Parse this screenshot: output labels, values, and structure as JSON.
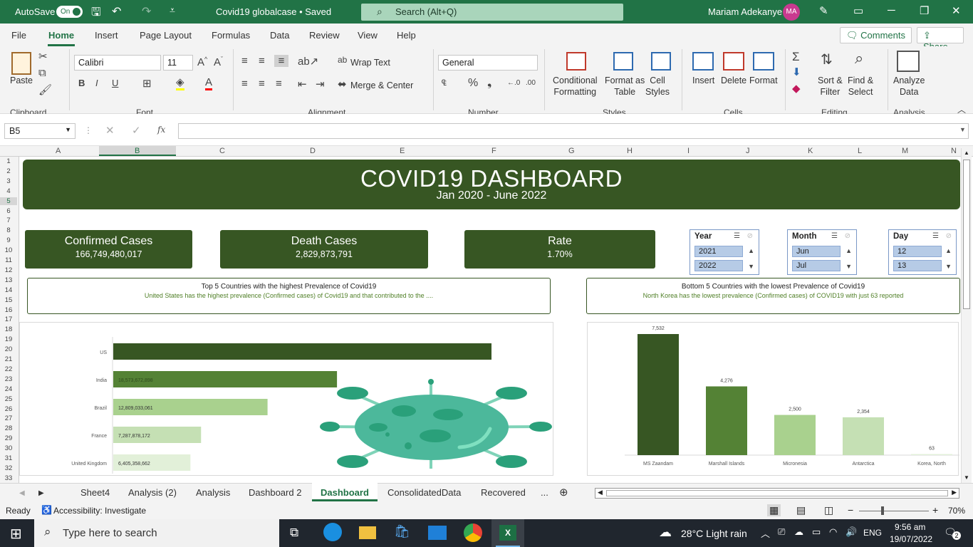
{
  "titlebar": {
    "autosave_label": "AutoSave",
    "autosave_state": "On",
    "doc_title": "Covid19 globalcase • Saved",
    "search_placeholder": "Search (Alt+Q)",
    "user_name": "Mariam Adekanye",
    "user_initials": "MA"
  },
  "menu": {
    "tabs": [
      "File",
      "Home",
      "Insert",
      "Page Layout",
      "Formulas",
      "Data",
      "Review",
      "View",
      "Help"
    ],
    "active": "Home",
    "comments_label": "Comments",
    "share_label": "Share"
  },
  "ribbon": {
    "paste_label": "Paste",
    "font_name": "Calibri",
    "font_size": "11",
    "wrap_text": "Wrap Text",
    "merge_center": "Merge & Center",
    "number_format": "General",
    "conditional_formatting": [
      "Conditional",
      "Formatting"
    ],
    "format_as_table": [
      "Format as",
      "Table"
    ],
    "cell_styles": [
      "Cell",
      "Styles"
    ],
    "insert": "Insert",
    "delete": "Delete",
    "format": "Format",
    "sort_filter": [
      "Sort &",
      "Filter"
    ],
    "find_select": [
      "Find &",
      "Select"
    ],
    "analyze_data": [
      "Analyze",
      "Data"
    ],
    "groups": [
      "Clipboard",
      "Font",
      "Alignment",
      "Number",
      "Styles",
      "Cells",
      "Editing",
      "Analysis"
    ]
  },
  "formula_bar": {
    "name_box": "B5",
    "fx": "fx",
    "content": ""
  },
  "columns": [
    "A",
    "B",
    "C",
    "D",
    "E",
    "F",
    "G",
    "H",
    "I",
    "J",
    "K",
    "L",
    "M",
    "N"
  ],
  "rows": [
    "1",
    "2",
    "3",
    "4",
    "5",
    "6",
    "7",
    "8",
    "9",
    "10",
    "11",
    "12",
    "13",
    "14",
    "15",
    "16",
    "17",
    "18",
    "19",
    "20",
    "21",
    "22",
    "23",
    "24",
    "25",
    "26",
    "27",
    "28",
    "29",
    "30",
    "31",
    "32",
    "33"
  ],
  "dashboard": {
    "title": "COVID19 DASHBOARD",
    "subtitle": "Jan 2020 - June 2022",
    "kpis": [
      {
        "label": "Confirmed Cases",
        "value": "166,749,480,017"
      },
      {
        "label": "Death Cases",
        "value": "2,829,873,791"
      },
      {
        "label": "Rate",
        "value": "1.70%"
      }
    ],
    "slicers": [
      {
        "title": "Year",
        "items": [
          "2021",
          "2022"
        ]
      },
      {
        "title": "Month",
        "items": [
          "Jun",
          "Jul"
        ]
      },
      {
        "title": "Day",
        "items": [
          "12",
          "13"
        ]
      }
    ],
    "top_box": {
      "heading": "Top 5 Countries with the highest Prevalence of Covid19",
      "text": "United States has the highest prevalence (Confirmed cases) of Covid19 and that contributed to the ...."
    },
    "bottom_box": {
      "heading": "Bottom 5 Countries with the lowest Prevalence of Covid19",
      "text": "North Korea has the lowest prevalence (Confirmed cases) of COVID19 with just 63 reported"
    }
  },
  "chart_data": [
    {
      "type": "bar",
      "orientation": "horizontal",
      "categories": [
        "US",
        "India",
        "Brazil",
        "France",
        "United Kingdom"
      ],
      "values": [
        31400000000,
        18573672898,
        12809033061,
        7287878172,
        6405358662
      ],
      "labels": [
        "",
        "18,573,672,898",
        "12,809,033,061",
        "7,287,878,172",
        "6,405,358,662"
      ],
      "colors": [
        "#375623",
        "#548235",
        "#a9d18e",
        "#c5e0b4",
        "#e2f0d9"
      ]
    },
    {
      "type": "bar",
      "orientation": "vertical",
      "categories": [
        "MS Zaandam",
        "Marshall Islands",
        "Micronesia",
        "Antarctica",
        "Korea, North"
      ],
      "values": [
        7532,
        4276,
        2500,
        2354,
        63
      ],
      "labels": [
        "7,532",
        "4,276",
        "2,500",
        "2,354",
        "63"
      ],
      "colors": [
        "#375623",
        "#548235",
        "#a9d18e",
        "#c5e0b4",
        "#e2f0d9"
      ]
    }
  ],
  "sheet_tabs": [
    "Sheet4",
    "Analysis (2)",
    "Analysis",
    "Dashboard 2",
    "Dashboard",
    "ConsolidatedData",
    "Recovered",
    "..."
  ],
  "active_sheet": "Dashboard",
  "status": {
    "ready": "Ready",
    "accessibility": "Accessibility: Investigate",
    "zoom": "70%"
  },
  "taskbar": {
    "search_placeholder": "Type here to search",
    "weather": "28°C  Light rain",
    "lang": "ENG",
    "time": "9:56 am",
    "date": "19/07/2022",
    "notif_count": "2"
  }
}
